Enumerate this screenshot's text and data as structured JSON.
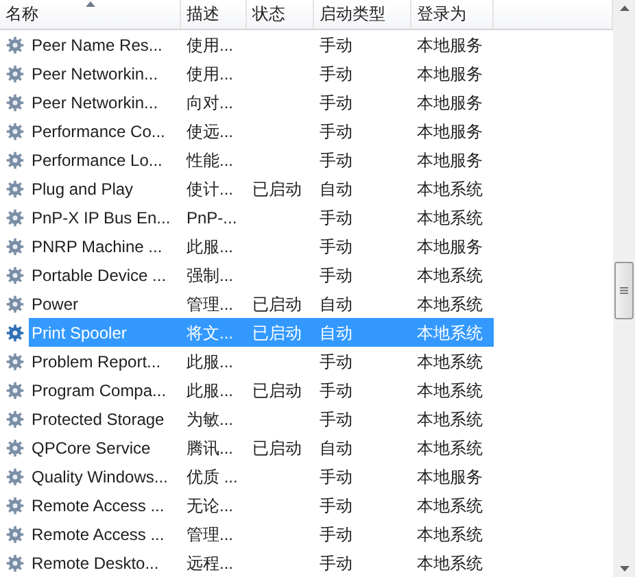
{
  "table": {
    "columns": [
      {
        "label": "名称",
        "sorted": true
      },
      {
        "label": "描述",
        "sorted": false
      },
      {
        "label": "状态",
        "sorted": false
      },
      {
        "label": "启动类型",
        "sorted": false
      },
      {
        "label": "登录为",
        "sorted": false
      }
    ],
    "rows": [
      {
        "name": "Peer Name Res...",
        "description": "使用...",
        "status": "",
        "startup": "手动",
        "logon": "本地服务",
        "selected": false
      },
      {
        "name": "Peer Networkin...",
        "description": "使用...",
        "status": "",
        "startup": "手动",
        "logon": "本地服务",
        "selected": false
      },
      {
        "name": "Peer Networkin...",
        "description": "向对...",
        "status": "",
        "startup": "手动",
        "logon": "本地服务",
        "selected": false
      },
      {
        "name": "Performance Co...",
        "description": "使远...",
        "status": "",
        "startup": "手动",
        "logon": "本地服务",
        "selected": false
      },
      {
        "name": "Performance Lo...",
        "description": "性能...",
        "status": "",
        "startup": "手动",
        "logon": "本地服务",
        "selected": false
      },
      {
        "name": "Plug and Play",
        "description": "使计...",
        "status": "已启动",
        "startup": "自动",
        "logon": "本地系统",
        "selected": false
      },
      {
        "name": "PnP-X IP Bus En...",
        "description": "PnP-...",
        "status": "",
        "startup": "手动",
        "logon": "本地系统",
        "selected": false
      },
      {
        "name": "PNRP Machine ...",
        "description": "此服...",
        "status": "",
        "startup": "手动",
        "logon": "本地服务",
        "selected": false
      },
      {
        "name": "Portable Device ...",
        "description": "强制...",
        "status": "",
        "startup": "手动",
        "logon": "本地系统",
        "selected": false
      },
      {
        "name": "Power",
        "description": "管理...",
        "status": "已启动",
        "startup": "自动",
        "logon": "本地系统",
        "selected": false
      },
      {
        "name": "Print Spooler",
        "description": "将文...",
        "status": "已启动",
        "startup": "自动",
        "logon": "本地系统",
        "selected": true
      },
      {
        "name": "Problem Report...",
        "description": "此服...",
        "status": "",
        "startup": "手动",
        "logon": "本地系统",
        "selected": false
      },
      {
        "name": "Program Compa...",
        "description": "此服...",
        "status": "已启动",
        "startup": "手动",
        "logon": "本地系统",
        "selected": false
      },
      {
        "name": "Protected Storage",
        "description": "为敏...",
        "status": "",
        "startup": "手动",
        "logon": "本地系统",
        "selected": false
      },
      {
        "name": "QPCore Service",
        "description": "腾讯...",
        "status": "已启动",
        "startup": "自动",
        "logon": "本地系统",
        "selected": false
      },
      {
        "name": "Quality Windows...",
        "description": "优质 ...",
        "status": "",
        "startup": "手动",
        "logon": "本地服务",
        "selected": false
      },
      {
        "name": "Remote Access ...",
        "description": "无论...",
        "status": "",
        "startup": "手动",
        "logon": "本地系统",
        "selected": false
      },
      {
        "name": "Remote Access ...",
        "description": "管理...",
        "status": "",
        "startup": "手动",
        "logon": "本地系统",
        "selected": false
      },
      {
        "name": "Remote Deskto...",
        "description": "远程...",
        "status": "",
        "startup": "手动",
        "logon": "本地系统",
        "selected": false
      }
    ]
  }
}
